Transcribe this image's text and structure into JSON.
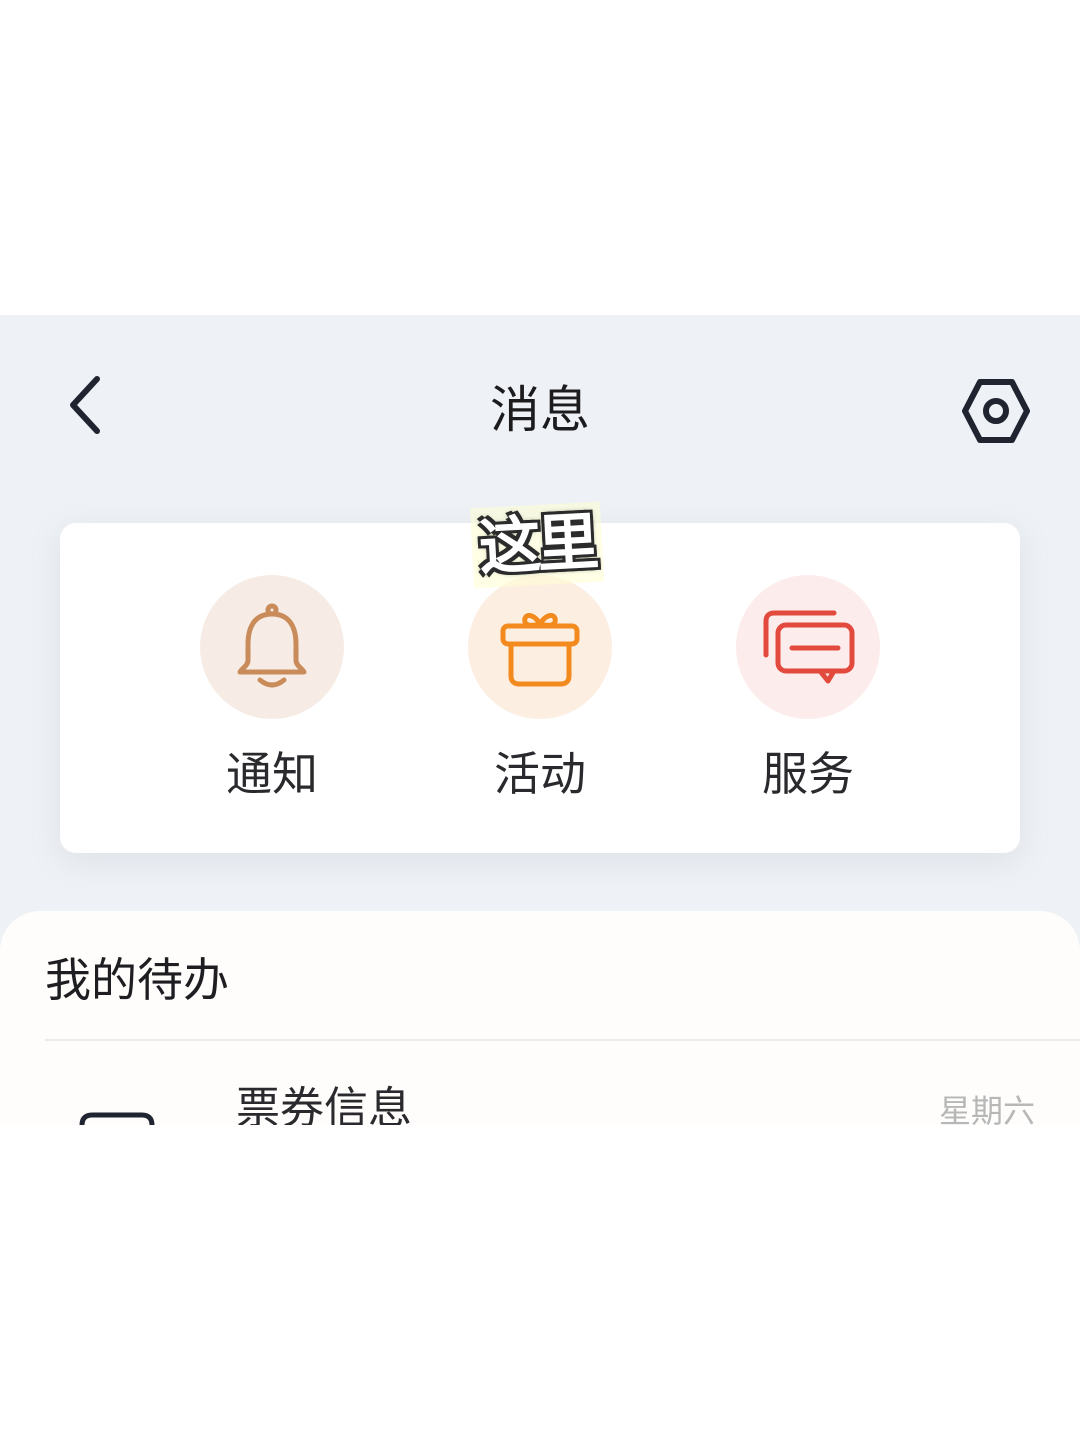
{
  "header": {
    "title": "消息",
    "back_icon": "chevron-left-icon",
    "settings_icon": "hexagon-gear-icon"
  },
  "overlay": {
    "text": "这里"
  },
  "categories": [
    {
      "label": "通知",
      "icon": "bell-icon",
      "color": "#c98b5a",
      "bg": "#f6ece5"
    },
    {
      "label": "活动",
      "icon": "gift-icon",
      "color": "#f28a1e",
      "bg": "#fdeee2"
    },
    {
      "label": "服务",
      "icon": "chat-bubbles-icon",
      "color": "#e24a3d",
      "bg": "#fcecec"
    }
  ],
  "todo": {
    "title": "我的待办",
    "items": [
      {
        "title": "票券信息",
        "date": "星期六"
      }
    ]
  }
}
